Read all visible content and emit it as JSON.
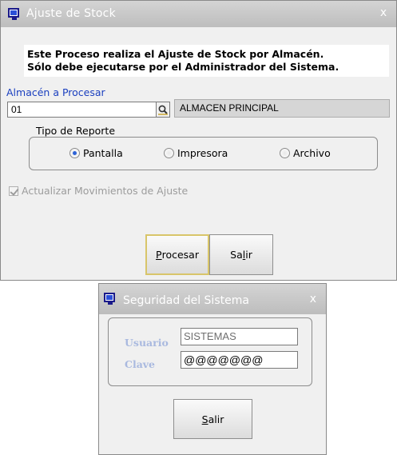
{
  "main_window": {
    "title": "Ajuste de Stock",
    "close_glyph": "x",
    "notice_line1": "Este Proceso realiza el Ajuste de Stock por Almacén.",
    "notice_line2": "Sólo debe ejecutarse por el Administrador del Sistema.",
    "almacen_label": "Almacén a Procesar",
    "almacen_code": "01",
    "almacen_name": "ALMACEN PRINCIPAL",
    "reporte": {
      "legend": "Tipo de Reporte",
      "options": [
        "Pantalla",
        "Impresora",
        "Archivo"
      ],
      "selected": "Pantalla"
    },
    "checkbox_label": "Actualizar Movimientos de Ajuste",
    "checkbox_checked": true,
    "procesar_mnemonic": "P",
    "procesar_rest": "rocesar",
    "salir_prefix": "Sa",
    "salir_mnemonic": "l",
    "salir_suffix": "ir"
  },
  "security_window": {
    "title": "Seguridad del Sistema",
    "close_glyph": "x",
    "usuario_label": "Usuario",
    "usuario_value": "SISTEMAS",
    "clave_label": "Clave",
    "clave_value": "@@@@@@@",
    "salir_mnemonic": "S",
    "salir_rest": "alir"
  },
  "icons": {
    "app": "app-window-icon",
    "search": "search-magnifier-icon"
  },
  "colors": {
    "title_bar": "#c8c8c8",
    "label_blue": "#1a3fbf",
    "focus_border": "#d8c56a"
  }
}
